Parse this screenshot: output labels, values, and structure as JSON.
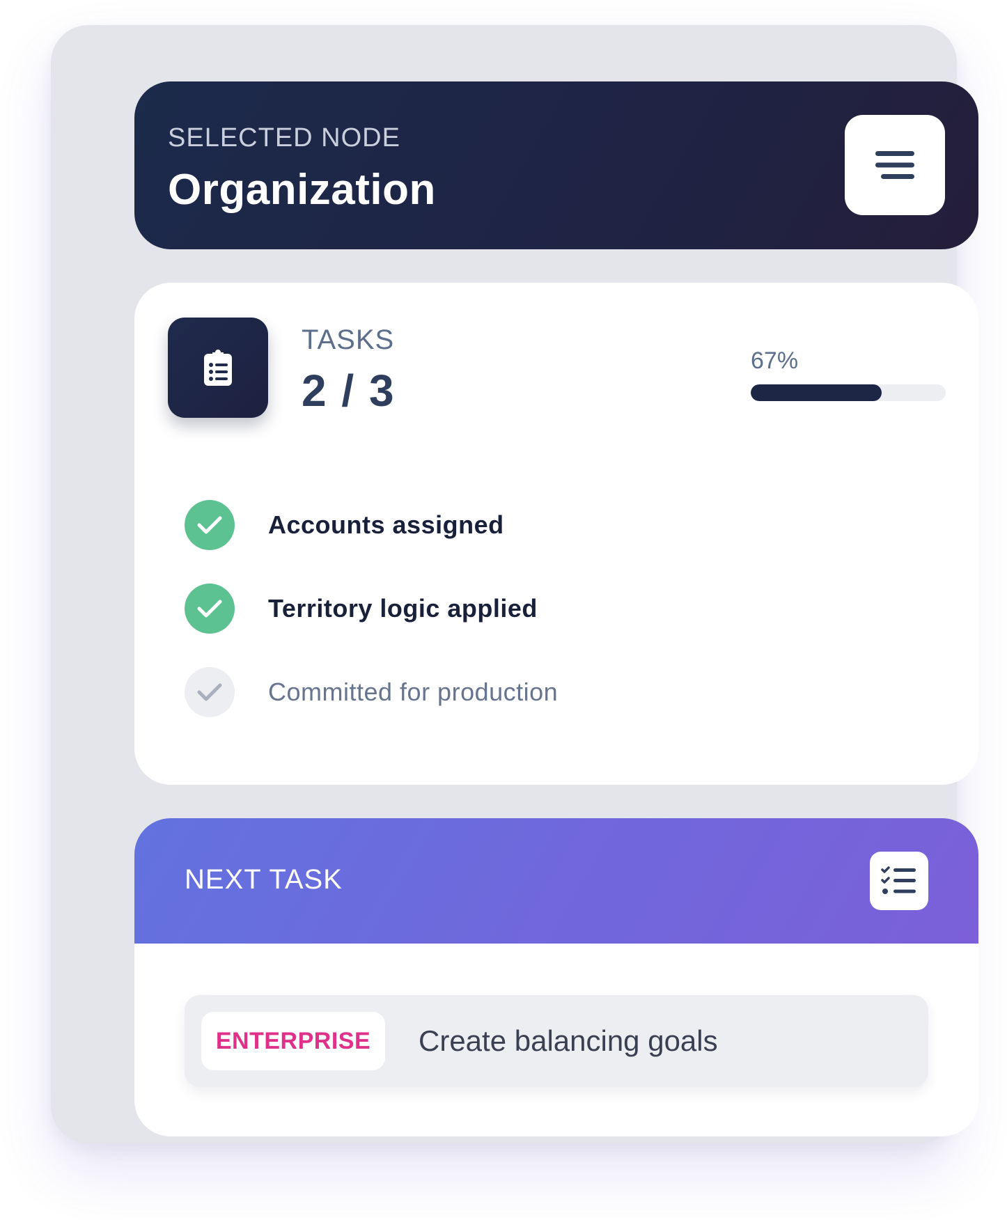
{
  "header": {
    "eyebrow": "SELECTED NODE",
    "title": "Organization",
    "menu_icon": "hamburger-menu-icon"
  },
  "tasks": {
    "label": "TASKS",
    "count": "2 / 3",
    "progress_label": "67%",
    "progress_fraction": 0.67,
    "icon": "clipboard-list-icon",
    "items": [
      {
        "text": "Accounts assigned",
        "done": true
      },
      {
        "text": "Territory logic applied",
        "done": true
      },
      {
        "text": "Committed for production",
        "done": false
      }
    ]
  },
  "next_task": {
    "title": "NEXT TASK",
    "icon": "checklist-icon",
    "tier": "ENTERPRISE",
    "text": "Create balancing goals"
  },
  "colors": {
    "header_bg": "#1f2344",
    "check_done": "#5cc291",
    "check_pending": "#eceef2",
    "progress_fill": "#1d2745",
    "next_gradient_start": "#6272de",
    "next_gradient_end": "#7b60d9",
    "tier_color": "#e0318a"
  }
}
